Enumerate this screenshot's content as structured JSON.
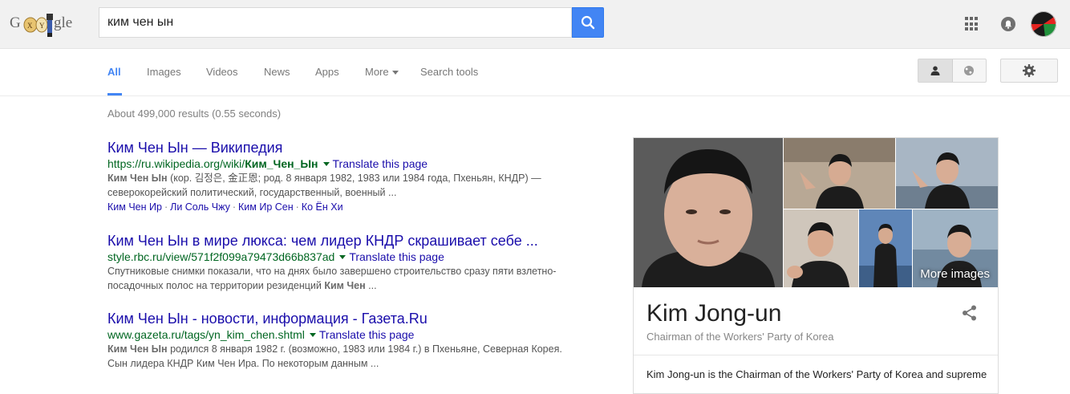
{
  "header": {
    "logo_text_left": "G",
    "logo_text_right": "gle",
    "search_value": "ким чен ын"
  },
  "tabs": [
    {
      "label": "All"
    },
    {
      "label": "Images"
    },
    {
      "label": "Videos"
    },
    {
      "label": "News"
    },
    {
      "label": "Apps"
    },
    {
      "label": "More"
    },
    {
      "label": "Search tools"
    }
  ],
  "stats": "About 499,000 results (0.55 seconds)",
  "results": [
    {
      "title": "Ким Чен Ын — Википедия",
      "url_prefix": "https://ru.wikipedia.org/wiki/",
      "url_bold": "Ким_Чен_Ын",
      "translate": "Translate this page",
      "snippet_bold": "Ким Чен Ын",
      "snippet_1": " (кор. 김정은, 金正恩; род. 8 января 1982, 1983 или 1984 года, Пхеньян, КНДР) —",
      "snippet_2": "северокорейский политический, государственный, военный ...",
      "sitelinks": [
        "Ким Чен Ир",
        "Ли Соль Чжу",
        "Ким Ир Сен",
        "Ко Ён Хи"
      ]
    },
    {
      "title": "Ким Чен Ын в мире люкса: чем лидер КНДР скрашивает себе ...",
      "url": "style.rbc.ru/view/571f2f099a79473d66b837ad",
      "translate": "Translate this page",
      "snippet_1": "Спутниковые снимки показали, что на днях было завершено строительство сразу пяти взлетно-",
      "snippet_2": "посадочных полос на территории резиденций ",
      "snippet_bold": "Ким Чен",
      "snippet_end": " ..."
    },
    {
      "title": "Ким Чен Ын - новости, информация - Газета.Ru",
      "url": "www.gazeta.ru/tags/yn_kim_chen.shtml",
      "translate": "Translate this page",
      "snippet_bold": "Ким Чен Ын",
      "snippet_1": " родился 8 января 1982 г. (возможно, 1983 или 1984 г.) в Пхеньяне, Северная Корея.",
      "snippet_2": "Сын лидера КНДР Ким Чен Ира. По некоторым данным ..."
    }
  ],
  "knowledge_panel": {
    "more_images": "More images",
    "title": "Kim Jong-un",
    "subtitle": "Chairman of the Workers' Party of Korea",
    "description": "Kim Jong-un is the Chairman of the Workers' Party of Korea and supreme"
  },
  "colors": {
    "accent": "#4285f4",
    "link": "#1a0dab",
    "url": "#006621"
  },
  "icons": [
    "search-icon",
    "apps-grid-icon",
    "notifications-icon",
    "person-icon",
    "globe-icon",
    "gear-icon",
    "share-icon"
  ]
}
